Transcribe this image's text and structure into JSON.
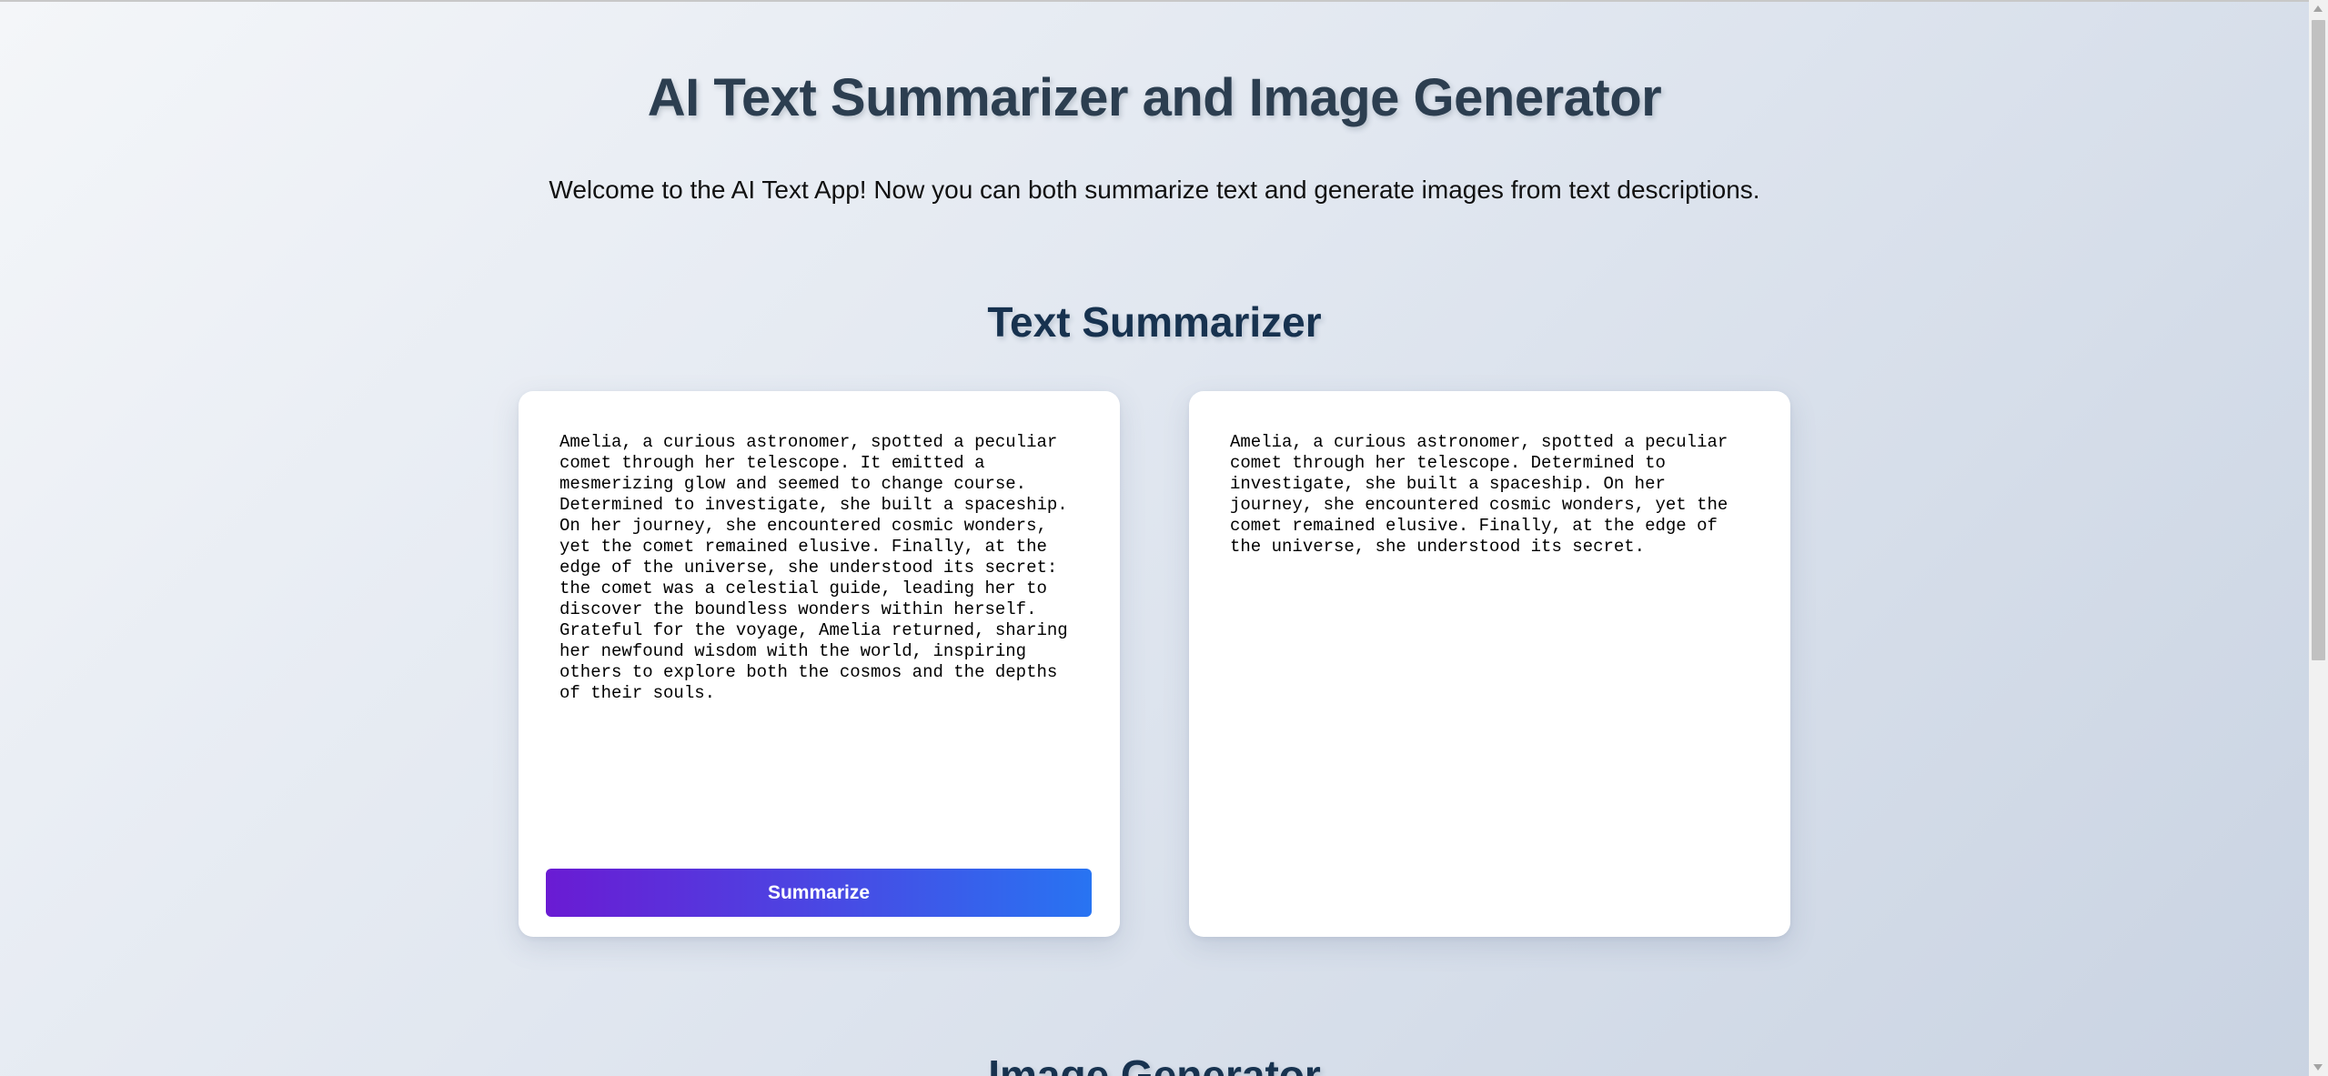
{
  "header": {
    "title": "AI Text Summarizer and Image Generator",
    "subtitle": "Welcome to the AI Text App! Now you can both summarize text and generate images from text descriptions."
  },
  "summarizer": {
    "section_title": "Text Summarizer",
    "input_text": "Amelia, a curious astronomer, spotted a peculiar comet through her telescope. It emitted a mesmerizing glow and seemed to change course. Determined to investigate, she built a spaceship. On her journey, she encountered cosmic wonders, yet the comet remained elusive. Finally, at the edge of the universe, she understood its secret: the comet was a celestial guide, leading her to discover the boundless wonders within herself. Grateful for the voyage, Amelia returned, sharing her newfound wisdom with the world, inspiring others to explore both the cosmos and the depths of their souls.",
    "summarize_label": "Summarize",
    "output_text": "Amelia, a curious astronomer, spotted a peculiar comet through her telescope. Determined to investigate, she built a spaceship. On her journey, she encountered cosmic wonders, yet the comet remained elusive. Finally, at the edge of the universe, she understood its secret."
  },
  "image_generator": {
    "section_title": "Image Generator"
  },
  "colors": {
    "title": "#2c3e50",
    "section_title": "#17324f",
    "button_gradient_start": "#6a1bd3",
    "button_gradient_end": "#2874f2"
  }
}
